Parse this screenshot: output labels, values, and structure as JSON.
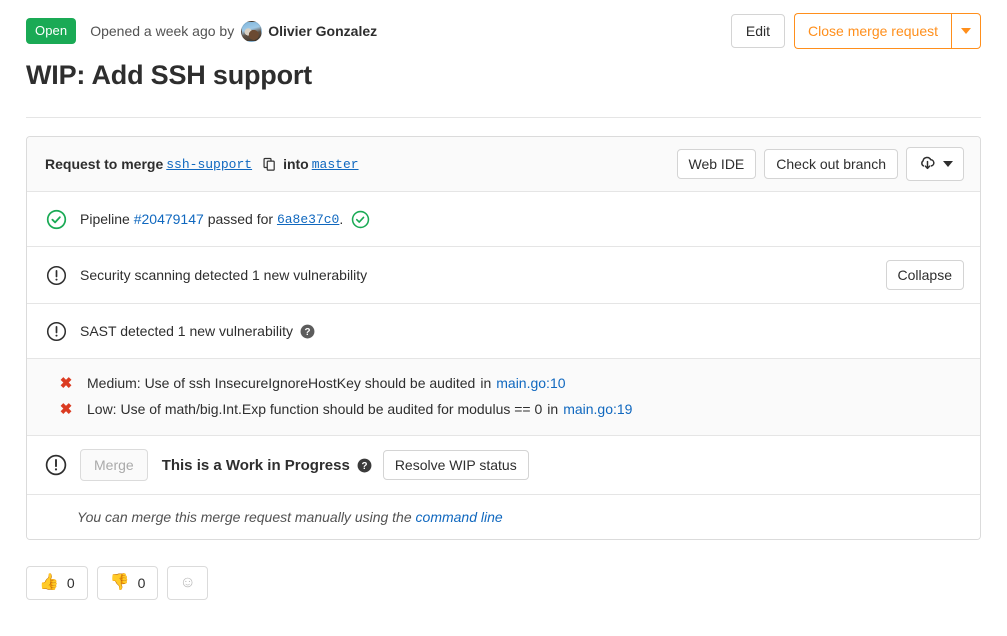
{
  "header": {
    "state_badge": "Open",
    "opened_prefix": "Opened a week ago by",
    "author": "Olivier Gonzalez",
    "avatar_name": "user-avatar",
    "edit_label": "Edit",
    "close_label": "Close merge request",
    "close_caret_name": "chevron-down-icon"
  },
  "title": "WIP: Add SSH support",
  "widget": {
    "merge_prefix": "Request to merge",
    "source_branch": "ssh-support",
    "copy_icon_name": "copy-icon",
    "merge_infix": "into",
    "target_branch": "master",
    "web_ide_label": "Web IDE",
    "checkout_label": "Check out branch",
    "download_icon_name": "download-code-icon",
    "download_caret_name": "chevron-down-icon"
  },
  "pipeline": {
    "icon_name": "status-success-icon",
    "prefix": "Pipeline",
    "pipeline_id": "#20479147",
    "middle": "passed for",
    "commit_sha": "6a8e37c0",
    "period": ".",
    "commit_status_icon_name": "commit-status-success-icon"
  },
  "security": {
    "icon_name": "status-warning-icon",
    "text": "Security scanning detected 1 new vulnerability",
    "collapse_label": "Collapse"
  },
  "sast": {
    "icon_name": "status-warning-icon",
    "text": "SAST detected 1 new vulnerability",
    "help_icon_name": "question-icon"
  },
  "vulnerabilities": [
    {
      "icon_name": "severity-critical-icon",
      "text": "Medium: Use of ssh InsecureIgnoreHostKey should be audited",
      "in_label": "in",
      "file_link": "main.go:10"
    },
    {
      "icon_name": "severity-critical-icon",
      "text": "Low: Use of math/big.Int.Exp function should be audited for modulus == 0",
      "in_label": "in",
      "file_link": "main.go:19"
    }
  ],
  "wip": {
    "icon_name": "status-warning-icon",
    "merge_label": "Merge",
    "status_text": "This is a Work in Progress",
    "help_icon_name": "question-icon",
    "resolve_label": "Resolve WIP status"
  },
  "manual_merge": {
    "text": "You can merge this merge request manually using the",
    "link_label": "command line"
  },
  "awards": [
    {
      "name": "thumbsup",
      "emoji": "👍",
      "count": "0"
    },
    {
      "name": "thumbsdown",
      "emoji": "👎",
      "count": "0"
    }
  ],
  "award_add": {
    "icon_name": "smiley-add-reaction-icon",
    "glyph": "☺"
  },
  "colors": {
    "green": "#1aaa55",
    "orange": "#ff8f1c",
    "link_blue": "#1068bf",
    "red": "#db3b21",
    "text": "#2e2e2e",
    "border": "#dbdbdb"
  }
}
